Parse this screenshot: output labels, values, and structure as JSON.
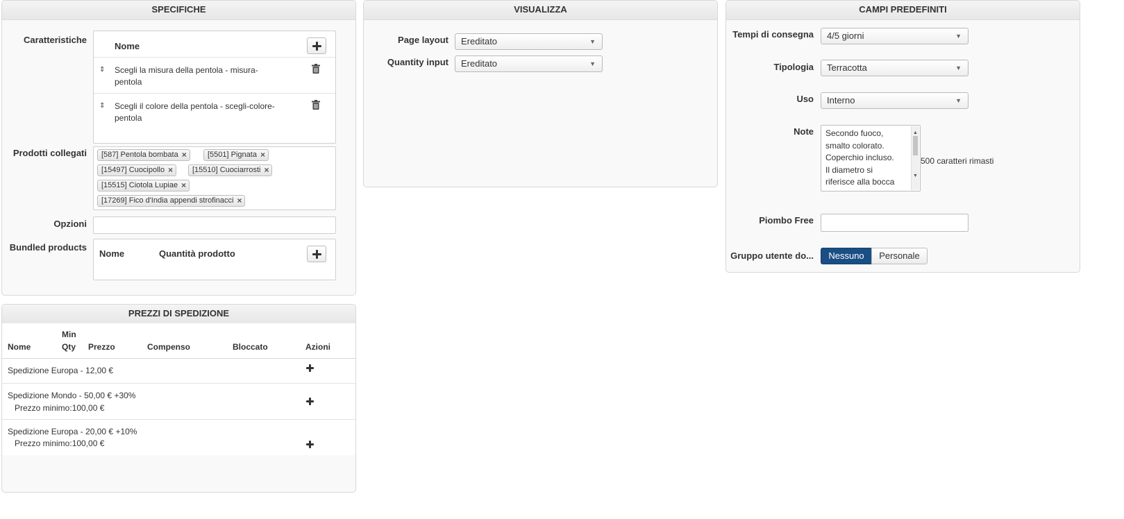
{
  "specifiche": {
    "title": "SPECIFICHE",
    "caratteristiche_label": "Caratteristiche",
    "features_header_name": "Nome",
    "features": [
      {
        "line1": "Scegli la misura della pentola - misura-",
        "line2": "pentola"
      },
      {
        "line1": "Scegli il colore della pentola - scegli-colore-",
        "line2": "pentola"
      }
    ],
    "prodotti_label": "Prodotti collegati",
    "tags": [
      "[587] Pentola bombata",
      "[5501] Pignata",
      "[15497] Cuocipollo",
      "[15510] Cuociarrosti",
      "[15515] Ciotola Lupiae",
      "[17269] Fico d'India appendi strofinacci"
    ],
    "opzioni_label": "Opzioni",
    "opzioni_value": "",
    "bundled_label": "Bundled products",
    "bundled_col_name": "Nome",
    "bundled_col_qty": "Quantità prodotto"
  },
  "spedizione": {
    "title": "PREZZI DI SPEDIZIONE",
    "col_nome": "Nome",
    "col_min": "Min",
    "col_qty": "Qty",
    "col_prezzo": "Prezzo",
    "col_compenso": "Compenso",
    "col_bloccato": "Bloccato",
    "col_azioni": "Azioni",
    "rows": [
      {
        "line1": "Spedizione Europa - 12,00 €",
        "line2": ""
      },
      {
        "line1": "Spedizione Mondo - 50,00 € +30%",
        "line2": "Prezzo minimo:100,00 €"
      },
      {
        "line1": "Spedizione Europa - 20,00 € +10%",
        "line2": "Prezzo minimo:100,00 €"
      }
    ]
  },
  "visualizza": {
    "title": "VISUALIZZA",
    "page_layout_label": "Page layout",
    "page_layout_value": "Ereditato",
    "quantity_input_label": "Quantity input",
    "quantity_input_value": "Ereditato"
  },
  "campi": {
    "title": "CAMPI PREDEFINITI",
    "tempi_label": "Tempi di consegna",
    "tempi_value": "4/5 giorni",
    "tipologia_label": "Tipologia",
    "tipologia_value": "Terracotta",
    "uso_label": "Uso",
    "uso_value": "Interno",
    "note_label": "Note",
    "note_lines": [
      "Secondo fuoco,",
      "smalto colorato.",
      "Coperchio incluso.",
      "Il diametro si",
      "riferisce alla bocca"
    ],
    "note_counter": "500 caratteri rimasti",
    "piombo_label": "Piombo Free",
    "piombo_value": "",
    "gruppo_label": "Gruppo utente do...",
    "gruppo_options": [
      "Nessuno",
      "Personale"
    ],
    "gruppo_selected": "Nessuno"
  },
  "colors": {
    "selected_segment": "#1a4e85",
    "panel_bg": "#f9f9f9"
  }
}
